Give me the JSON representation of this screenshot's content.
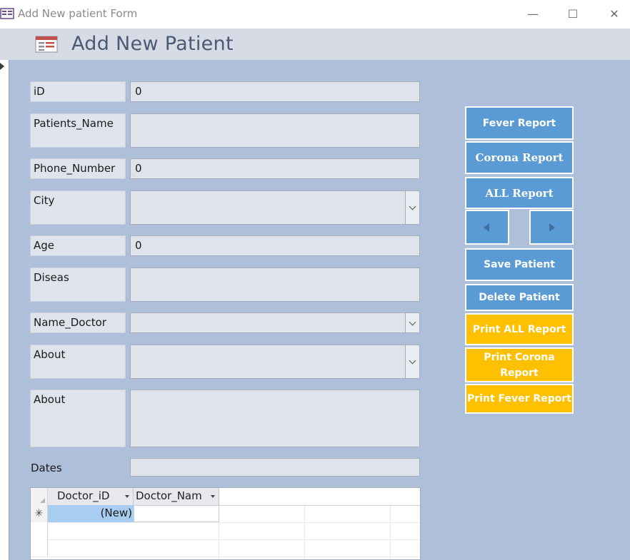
{
  "window": {
    "title": "Add New patient Form",
    "minimize_glyph": "—",
    "maximize_glyph": "☐",
    "close_glyph": "✕"
  },
  "header": {
    "heading": "Add New Patient",
    "icon": "form-icon"
  },
  "form": {
    "fields": [
      {
        "label": "iD",
        "value": "0"
      },
      {
        "label": "Patients_Name",
        "value": ""
      },
      {
        "label": "Phone_Number",
        "value": "0"
      },
      {
        "label": "City",
        "value": ""
      },
      {
        "label": "Age",
        "value": "0"
      },
      {
        "label": "Diseas",
        "value": ""
      },
      {
        "label": "Name_Doctor",
        "value": ""
      },
      {
        "label": "About",
        "value": ""
      },
      {
        "label": "About",
        "value": ""
      },
      {
        "label": "Dates",
        "value": ""
      }
    ]
  },
  "buttons": {
    "fever_report": "Fever Report",
    "corona_report": "Corona Report",
    "all_report": "ALL Report",
    "save_patient": "Save Patient",
    "delete_patient": "Delete Patient",
    "print_all_report": "Print ALL Report",
    "print_corona_report": "Print Corona Report",
    "print_fever_report": "Print Fever Report"
  },
  "subform": {
    "columns": [
      "Doctor_iD",
      "Doctor_Nam"
    ],
    "new_row_marker": "✳",
    "new_row_value": "(New)"
  },
  "colors": {
    "detail_bg": "#adbfd9",
    "header_bg": "#d6dbe5",
    "button_blue": "#5b9bd5",
    "button_gold": "#ffc000"
  }
}
